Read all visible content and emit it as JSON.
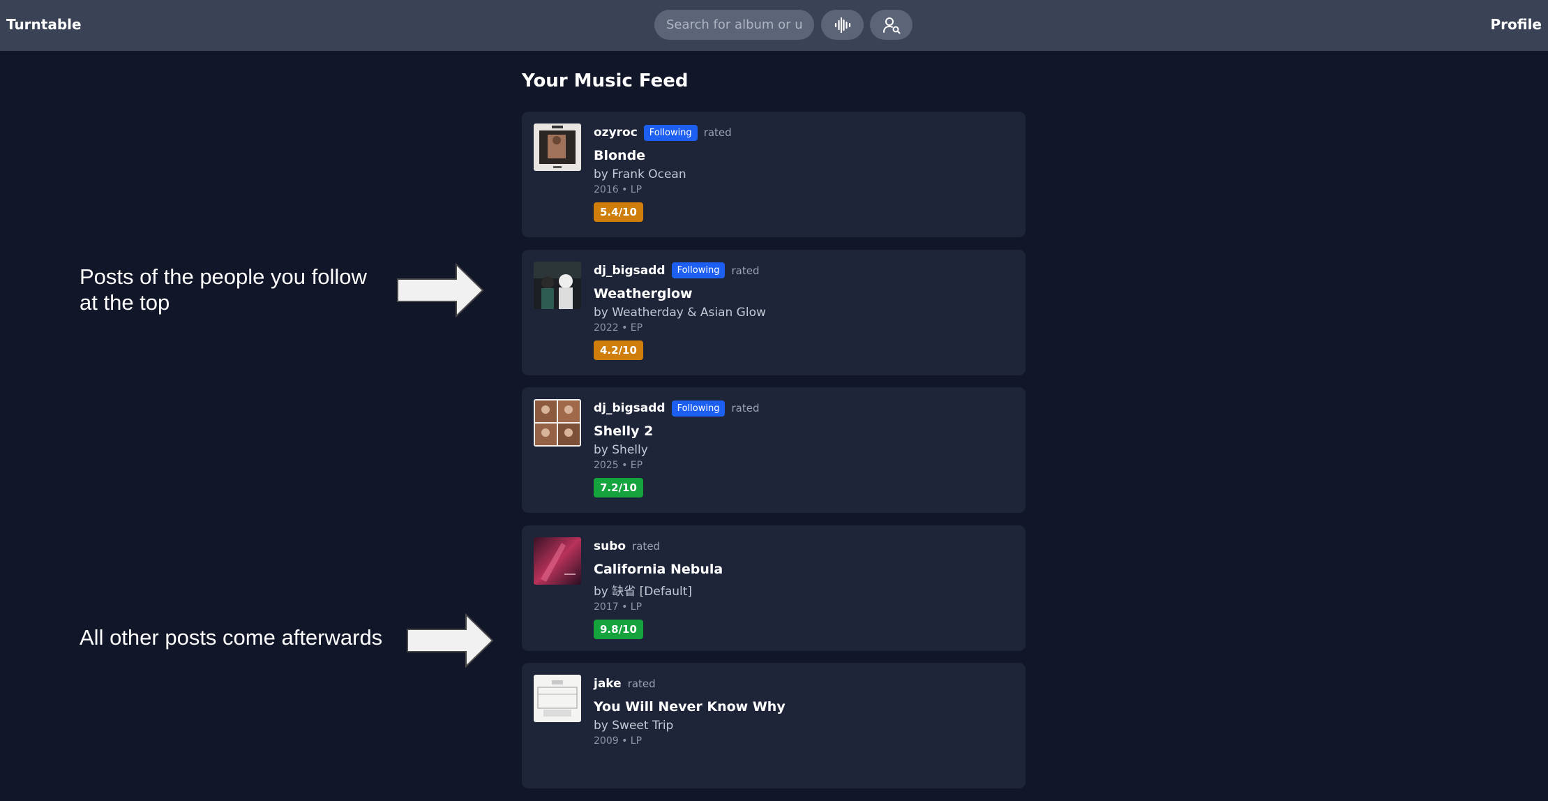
{
  "header": {
    "brand": "Turntable",
    "search_placeholder": "Search for album or user...",
    "audio_icon": "waveform-icon",
    "user_search_icon": "user-search-icon",
    "profile_label": "Profile"
  },
  "feed": {
    "title": "Your Music Feed",
    "posts": [
      {
        "username": "ozyroc",
        "badge": "Following",
        "action": "rated",
        "album": "Blonde",
        "artist": "by Frank Ocean",
        "info": "2016 • LP",
        "rating": "5.4/10"
      },
      {
        "username": "dj_bigsadd",
        "badge": "Following",
        "action": "rated",
        "album": "Weatherglow",
        "artist": "by Weatherday & Asian Glow",
        "info": "2022 • EP",
        "rating": "4.2/10"
      },
      {
        "username": "dj_bigsadd",
        "badge": "Following",
        "action": "rated",
        "album": "Shelly 2",
        "artist": "by Shelly",
        "info": "2025 • EP",
        "rating": "7.2/10"
      },
      {
        "username": "subo",
        "action": "rated",
        "album": "California Nebula",
        "artist": "by 缺省 [Default]",
        "info": "2017 • LP",
        "rating": "9.8/10"
      },
      {
        "username": "jake",
        "action": "rated",
        "album": "You Will Never Know Why",
        "artist": "by Sweet Trip",
        "info": "2009 • LP"
      }
    ]
  },
  "annotations": {
    "top_line1": "Posts of the people you follow",
    "top_line2": "at the top",
    "bottom": "All other posts come afterwards"
  },
  "colors": {
    "page_bg": "#111628",
    "nav_bg": "#3a4356",
    "card_bg": "#1e2538",
    "following_badge": "#1d5ff0",
    "rating_mid": "#cf7d0b",
    "rating_high": "#15a33e"
  }
}
